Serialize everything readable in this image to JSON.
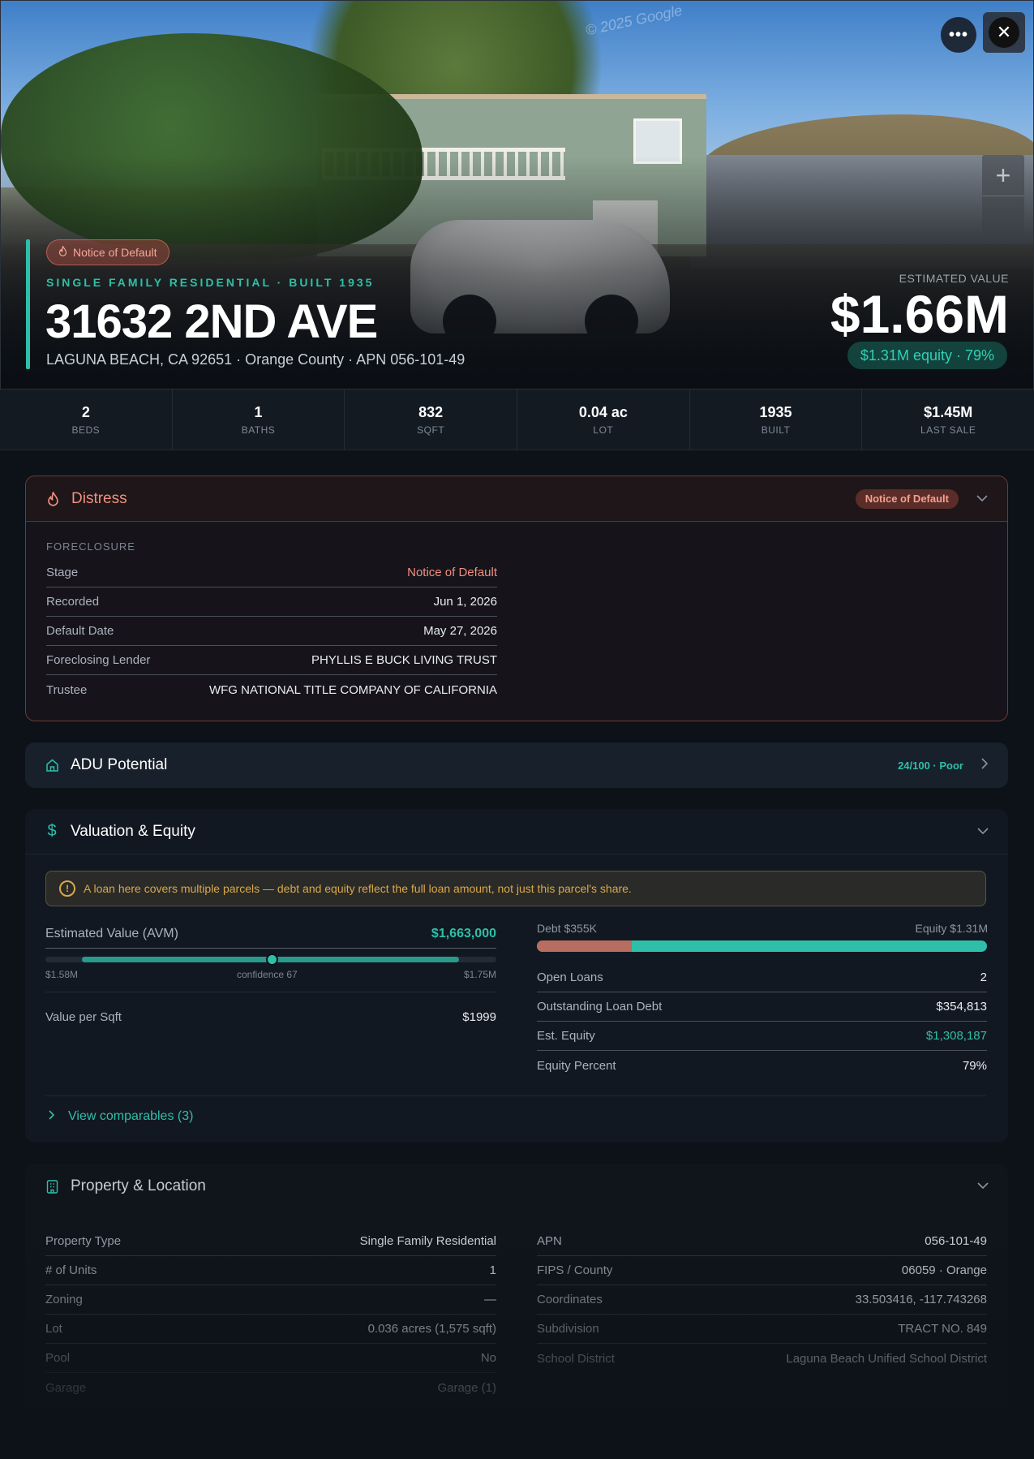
{
  "hero": {
    "watermark": "© 2025 Google",
    "more_icon": "more-horizontal-icon",
    "close_icon": "close-icon",
    "zoom_in": "+",
    "status_badge": "Notice of Default",
    "subtitle": "SINGLE FAMILY RESIDENTIAL · BUILT 1935",
    "title": "31632 2ND AVE",
    "address": "LAGUNA BEACH, CA 92651 · Orange County · APN 056-101-49",
    "estimated_value_label": "ESTIMATED VALUE",
    "estimated_value": "$1.66M",
    "equity_pill": "$1.31M equity · 79%"
  },
  "stats": [
    {
      "value": "2",
      "label": "BEDS"
    },
    {
      "value": "1",
      "label": "BATHS"
    },
    {
      "value": "832",
      "label": "SQFT"
    },
    {
      "value": "0.04 ac",
      "label": "LOT"
    },
    {
      "value": "1935",
      "label": "BUILT"
    },
    {
      "value": "$1.45M",
      "label": "LAST SALE"
    }
  ],
  "distress": {
    "title": "Distress",
    "badge": "Notice of Default",
    "section": "FORECLOSURE",
    "rows": [
      {
        "k": "Stage",
        "v": "Notice of Default"
      },
      {
        "k": "Recorded",
        "v": "Jun 1, 2026"
      },
      {
        "k": "Default Date",
        "v": "May 27, 2026"
      },
      {
        "k": "Foreclosing Lender",
        "v": "PHYLLIS E BUCK LIVING TRUST"
      },
      {
        "k": "Trustee",
        "v": "WFG NATIONAL TITLE COMPANY OF CALIFORNIA"
      }
    ],
    "accent_color": "#f09080"
  },
  "adu": {
    "title": "ADU Potential",
    "score": "24/100 · Poor"
  },
  "valuation": {
    "title": "Valuation & Equity",
    "notice": "A loan here covers multiple parcels — debt and equity reflect the full loan amount, not just this parcel's share.",
    "avm_label": "Estimated Value (AVM)",
    "avm_value": "$1,663,000",
    "range_low": "$1.58M",
    "range_high": "$1.75M",
    "confidence": "confidence 67",
    "value_per_sqft_label": "Value per Sqft",
    "value_per_sqft": "$1999",
    "debt_label": "Debt $355K",
    "equity_label": "Equity $1.31M",
    "equity_fraction": 0.79,
    "rows": [
      {
        "k": "Open Loans",
        "v": "2"
      },
      {
        "k": "Outstanding Loan Debt",
        "v": "$354,813"
      },
      {
        "k": "Est. Equity",
        "v": "$1,308,187"
      },
      {
        "k": "Equity Percent",
        "v": "79%"
      }
    ],
    "comparables": "View comparables (3)",
    "accent_color": "#2fbfa9"
  },
  "property": {
    "title": "Property & Location",
    "left": [
      {
        "k": "Property Type",
        "v": "Single Family Residential"
      },
      {
        "k": "# of Units",
        "v": "1"
      },
      {
        "k": "Zoning",
        "v": "—"
      },
      {
        "k": "Lot",
        "v": "0.036 acres (1,575 sqft)"
      },
      {
        "k": "Pool",
        "v": "No"
      },
      {
        "k": "Garage",
        "v": "Garage (1)"
      }
    ],
    "right": [
      {
        "k": "APN",
        "v": "056-101-49"
      },
      {
        "k": "FIPS / County",
        "v": "06059 · Orange"
      },
      {
        "k": "Coordinates",
        "v": "33.503416, -117.743268"
      },
      {
        "k": "Subdivision",
        "v": "TRACT NO. 849"
      },
      {
        "k": "School District",
        "v": "Laguna Beach Unified School District"
      }
    ]
  }
}
